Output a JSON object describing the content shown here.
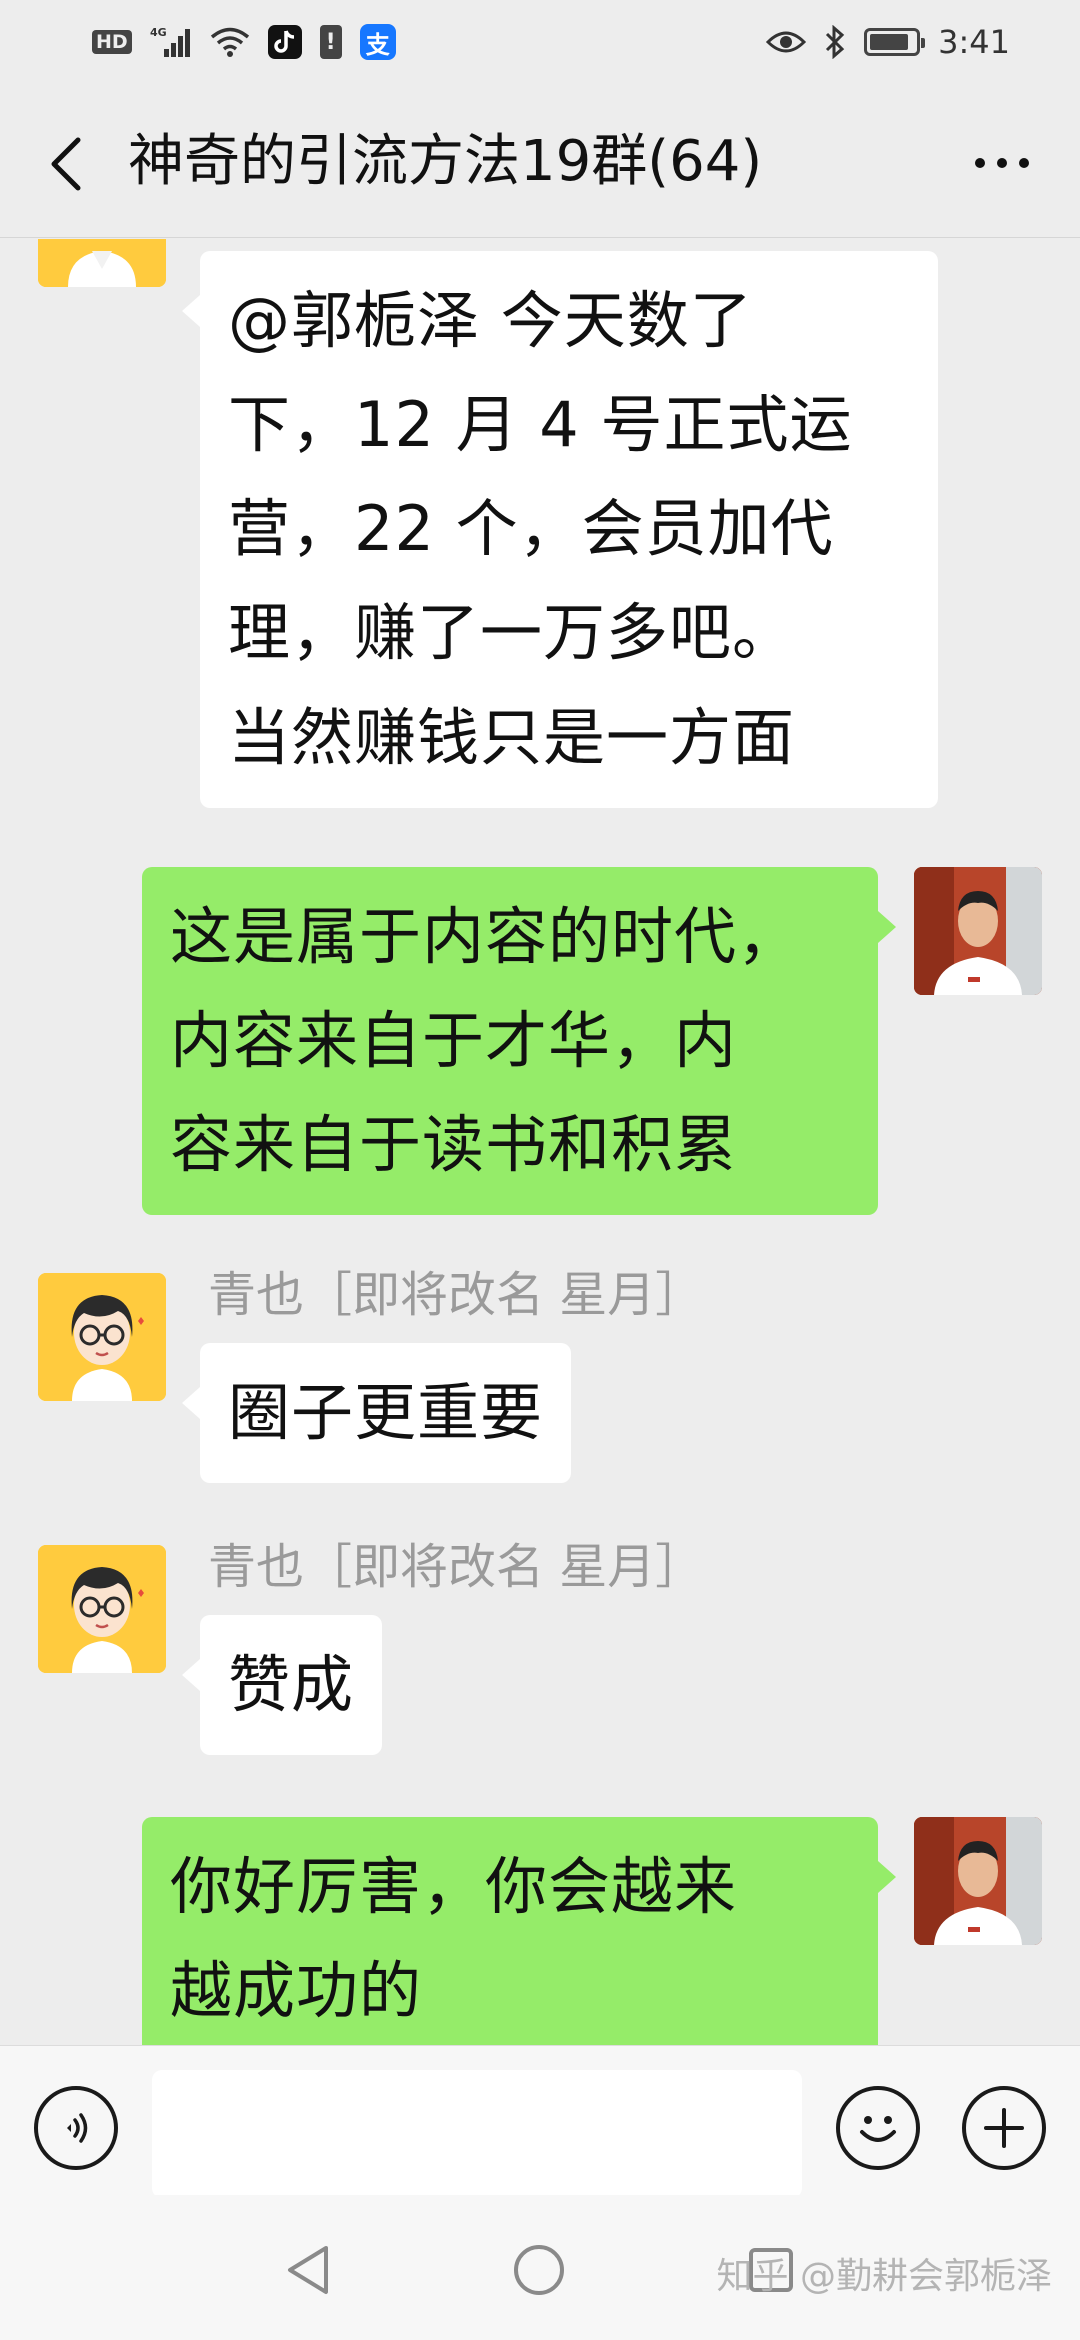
{
  "status_bar": {
    "hd": "HD",
    "network": "4G",
    "alipay_glyph": "支",
    "time": "3:41",
    "battery_level": 0.85
  },
  "header": {
    "title": "神奇的引流方法19群(64)"
  },
  "messages": [
    {
      "side": "left",
      "sender": "",
      "text": "@郭栀泽  今天数了\n下，12 月 4 号正式运\n营，22 个，会员加代\n理，赚了一万多吧。\n当然赚钱只是一方面"
    },
    {
      "side": "right",
      "text": "这是属于内容的时代，\n内容来自于才华，内\n容来自于读书和积累"
    },
    {
      "side": "left",
      "sender": "青也［即将改名 星月］",
      "text": "圈子更重要"
    },
    {
      "side": "left",
      "sender": "青也［即将改名 星月］",
      "text": "赞成"
    },
    {
      "side": "right",
      "text": "你好厉害，你会越来\n越成功的"
    }
  ],
  "input_bar": {
    "placeholder": ""
  },
  "watermark": "知乎 @勤耕会郭栀泽",
  "colors": {
    "background": "#ededed",
    "bubble_out": "#95ec69",
    "bubble_in": "#ffffff",
    "avatar_girl_bg": "#ffcb3e"
  }
}
